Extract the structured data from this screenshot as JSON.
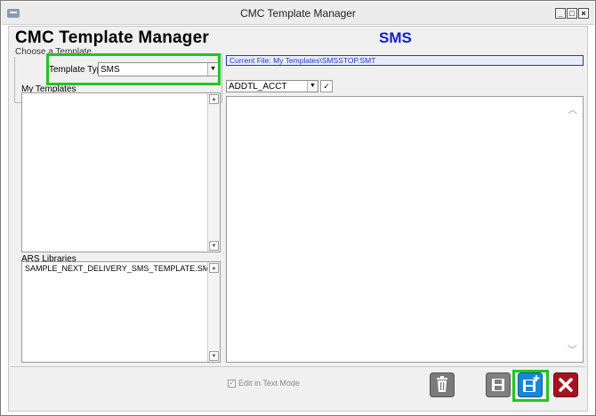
{
  "window": {
    "title": "CMC Template Manager"
  },
  "header": {
    "app_title": "CMC Template Manager",
    "template_type_heading": "SMS"
  },
  "choose": {
    "legend": "Choose a Template",
    "template_type_label": "Template Type",
    "template_type_value": "SMS"
  },
  "my_templates": {
    "label": "My Templates",
    "items": []
  },
  "ars": {
    "label": "ARS Libraries",
    "items": [
      "SAMPLE_NEXT_DELIVERY_SMS_TEMPLATE.SMT"
    ]
  },
  "editor": {
    "current_file": "Current File: My Templates\\SMSSTOP.SMT",
    "field_value": "ADDTL_ACCT",
    "insert_icon": "check-icon"
  },
  "footer": {
    "edit_text_mode_label": "Edit in Text Mode",
    "edit_text_mode_checked": true
  },
  "actions": {
    "delete_icon": "trash-icon",
    "save_icon": "save-icon",
    "save_as_icon": "save-as-icon",
    "close_icon": "close-icon"
  },
  "colors": {
    "heading_blue": "#1520c8",
    "highlight_green": "#22c522",
    "save_as_blue": "#1a86d8",
    "close_red": "#a31420"
  }
}
